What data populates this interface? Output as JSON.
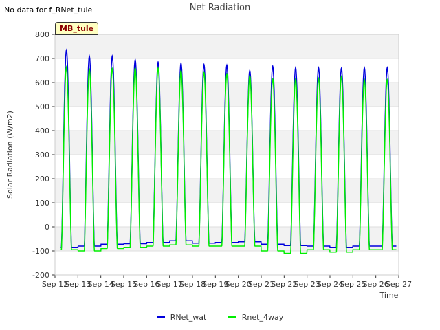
{
  "header": {
    "no_data_text": "No data for f_RNet_tule",
    "title": "Net Radiation"
  },
  "badge": {
    "label": "MB_tule"
  },
  "chart_data": {
    "type": "line",
    "title": "Net Radiation",
    "xlabel": "Time",
    "ylabel": "Solar Radiation (W/m2)",
    "ylim": [
      -200,
      800
    ],
    "yticks": [
      -200,
      -100,
      0,
      100,
      200,
      300,
      400,
      500,
      600,
      700,
      800
    ],
    "xlim": [
      12,
      27
    ],
    "xticks": [
      {
        "value": 12,
        "label": "Sep 12"
      },
      {
        "value": 13,
        "label": "Sep 13"
      },
      {
        "value": 14,
        "label": "Sep 14"
      },
      {
        "value": 15,
        "label": "Sep 15"
      },
      {
        "value": 16,
        "label": "Sep 16"
      },
      {
        "value": 17,
        "label": "Sep 17"
      },
      {
        "value": 18,
        "label": "Sep 18"
      },
      {
        "value": 19,
        "label": "Sep 19"
      },
      {
        "value": 20,
        "label": "Sep 20"
      },
      {
        "value": 21,
        "label": "Sep 21"
      },
      {
        "value": 22,
        "label": "Sep 22"
      },
      {
        "value": 23,
        "label": "Sep 23"
      },
      {
        "value": 24,
        "label": "Sep 24"
      },
      {
        "value": 25,
        "label": "Sep 25"
      },
      {
        "value": 26,
        "label": "Sep 26"
      },
      {
        "value": 27,
        "label": "Sep 27"
      }
    ],
    "grid": true,
    "legend_position": "bottom-center",
    "series": [
      {
        "name": "RNet_wat",
        "color": "#0000dd",
        "daily_peak": [
          735,
          710,
          710,
          695,
          685,
          680,
          675,
          672,
          650,
          668,
          662,
          662,
          660,
          662
        ],
        "daily_night": [
          -85,
          -80,
          -72,
          -70,
          -65,
          -58,
          -68,
          -65,
          -62,
          -72,
          -78,
          -80,
          -85,
          -80
        ],
        "x_start": 12.25,
        "x_end": 26.9
      },
      {
        "name": "Rnet_4way",
        "color": "#00ee00",
        "daily_peak": [
          665,
          655,
          658,
          660,
          660,
          650,
          642,
          635,
          628,
          615,
          615,
          618,
          625,
          612
        ],
        "daily_night": [
          -95,
          -100,
          -90,
          -85,
          -80,
          -75,
          -80,
          -80,
          -80,
          -100,
          -110,
          -95,
          -105,
          -95
        ],
        "x_start": 12.25,
        "x_end": 26.9
      }
    ]
  },
  "legend": {
    "items": [
      {
        "label": "RNet_wat",
        "color": "#0000dd"
      },
      {
        "label": "Rnet_4way",
        "color": "#00ee00"
      }
    ]
  }
}
